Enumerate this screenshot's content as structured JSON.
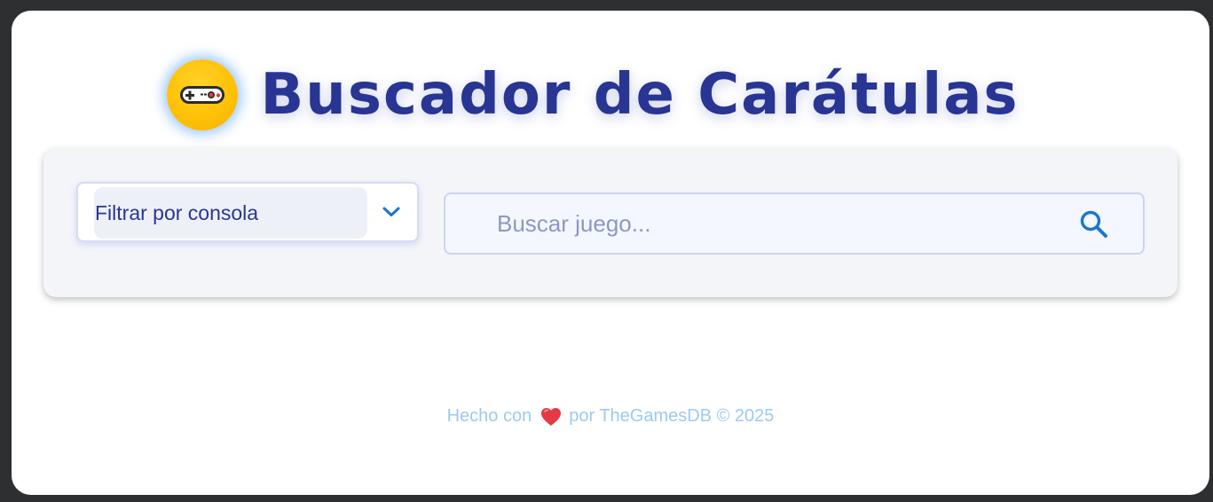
{
  "header": {
    "logo_icon": "gamepad-icon",
    "title": "Buscador de Carátulas"
  },
  "filter": {
    "label": "Filtrar por consola",
    "icon": "chevron-down-icon"
  },
  "search": {
    "placeholder": "Buscar juego...",
    "value": "",
    "icon": "search-icon"
  },
  "footer": {
    "prefix": "Hecho con",
    "heart_icon": "heart-icon",
    "suffix": "por TheGamesDB © 2025"
  },
  "colors": {
    "title": "#283593",
    "logo": "#ffc107",
    "accent": "#1976d2",
    "footer": "#9ccaf0",
    "heart": "#e53945"
  }
}
